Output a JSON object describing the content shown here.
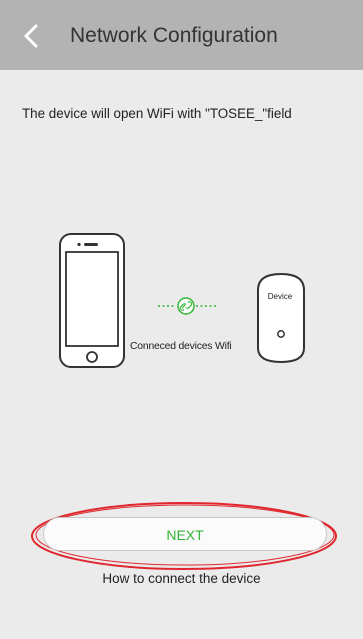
{
  "header": {
    "title": "Network Configuration",
    "back_icon": "chevron-left-icon"
  },
  "instructions": {
    "text": "The device will open WiFi with \"TOSEE_\"field"
  },
  "illustration": {
    "phone_icon": "smartphone-icon",
    "link_icon": "link-icon",
    "connection_label": "Conneced devices Wifi",
    "device_label": "Device"
  },
  "actions": {
    "next_label": "NEXT",
    "help_link": "How to connect the device"
  },
  "colors": {
    "header_bg": "#b3b3b3",
    "page_bg": "#ebebeb",
    "accent_green": "#33b533",
    "annotation_red": "#e0272f"
  }
}
